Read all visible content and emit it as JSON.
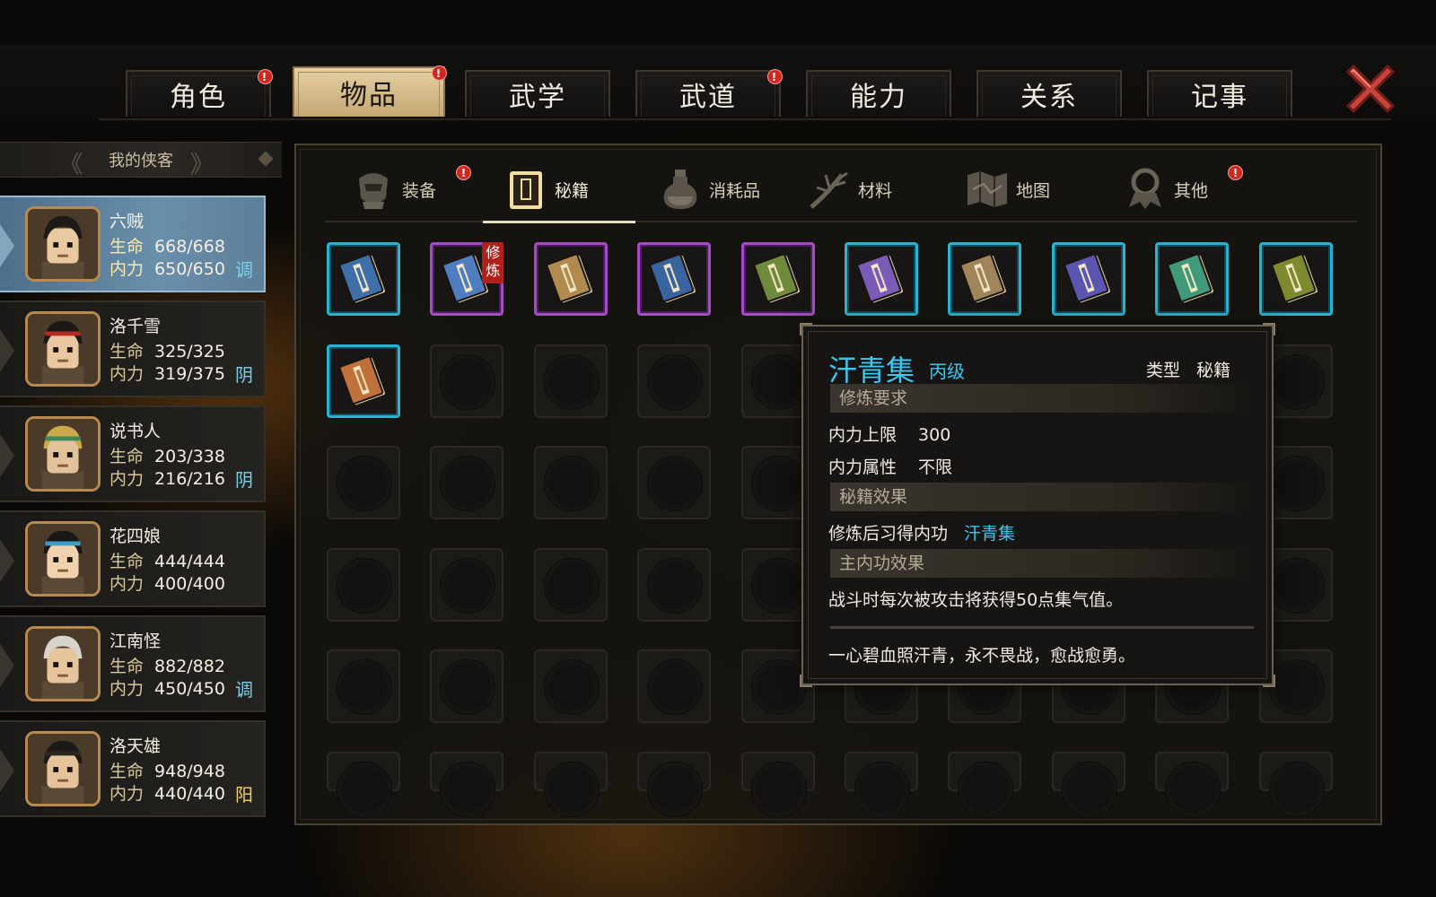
{
  "top_tabs": [
    {
      "label": "角色",
      "badge": "!"
    },
    {
      "label": "物品",
      "badge": "!"
    },
    {
      "label": "武学",
      "badge": ""
    },
    {
      "label": "武道",
      "badge": "!"
    },
    {
      "label": "能力",
      "badge": ""
    },
    {
      "label": "关系",
      "badge": ""
    },
    {
      "label": "记事",
      "badge": ""
    }
  ],
  "active_tab": "物品",
  "roster": {
    "header": "我的侠客",
    "hp_label": "生命",
    "mp_label": "内力",
    "characters": [
      {
        "name": "六贼",
        "hp": "668/668",
        "mp": "650/650",
        "attr": "调"
      },
      {
        "name": "洛千雪",
        "hp": "325/325",
        "mp": "319/375",
        "attr": "阴"
      },
      {
        "name": "说书人",
        "hp": "203/338",
        "mp": "216/216",
        "attr": "阴"
      },
      {
        "name": "花四娘",
        "hp": "444/444",
        "mp": "400/400",
        "attr": ""
      },
      {
        "name": "江南怪",
        "hp": "882/882",
        "mp": "450/450",
        "attr": "调"
      },
      {
        "name": "洛天雄",
        "hp": "948/948",
        "mp": "440/440",
        "attr": "阳"
      }
    ]
  },
  "sub_tabs": [
    {
      "label": "装备",
      "icon": "armor-icon",
      "badge": "!"
    },
    {
      "label": "秘籍",
      "icon": "book-icon",
      "badge": ""
    },
    {
      "label": "消耗品",
      "icon": "potion-icon",
      "badge": ""
    },
    {
      "label": "材料",
      "icon": "herb-icon",
      "badge": ""
    },
    {
      "label": "地图",
      "icon": "map-icon",
      "badge": ""
    },
    {
      "label": "其他",
      "icon": "misc-icon",
      "badge": "!"
    }
  ],
  "inventory": {
    "train_tag": "修炼",
    "items": [
      {
        "frame": "blue",
        "book": "#3e6fa8"
      },
      {
        "frame": "purple",
        "book": "#4f7dbf",
        "tag": true
      },
      {
        "frame": "purple",
        "book": "#b08a4e"
      },
      {
        "frame": "purple",
        "book": "#3a64a0"
      },
      {
        "frame": "purple",
        "book": "#6e8a3a"
      },
      {
        "frame": "blue",
        "book": "#7b5bb8"
      },
      {
        "frame": "blue",
        "book": "#a0845a"
      },
      {
        "frame": "blue",
        "book": "#5a56b0"
      },
      {
        "frame": "blue",
        "book": "#3f9a7a"
      },
      {
        "frame": "blue",
        "book": "#7e8a30"
      },
      {
        "frame": "blue",
        "book": "#c0703a"
      }
    ]
  },
  "tooltip": {
    "title": "汗青集",
    "grade": "丙级",
    "type_label": "类型",
    "type_value": "秘籍",
    "section_requirements": "修炼要求",
    "req_mp_label": "内力上限",
    "req_mp_value": "300",
    "req_attr_label": "内力属性",
    "req_attr_value": "不限",
    "section_effect": "秘籍效果",
    "effect_label": "修炼后习得内功",
    "effect_value": "汗青集",
    "section_main": "主内功效果",
    "main_effect": "战斗时每次被攻击将获得50点集气值。",
    "flavor": "一心碧血照汗青，永不畏战，愈战愈勇。"
  },
  "colors": {
    "rarity_blue": "#2ab3cf",
    "rarity_purple": "#a64ac8",
    "highlight_cyan": "#3cc8f0",
    "active_tab": "#d9bf8c",
    "badge_red": "#d2271f"
  }
}
